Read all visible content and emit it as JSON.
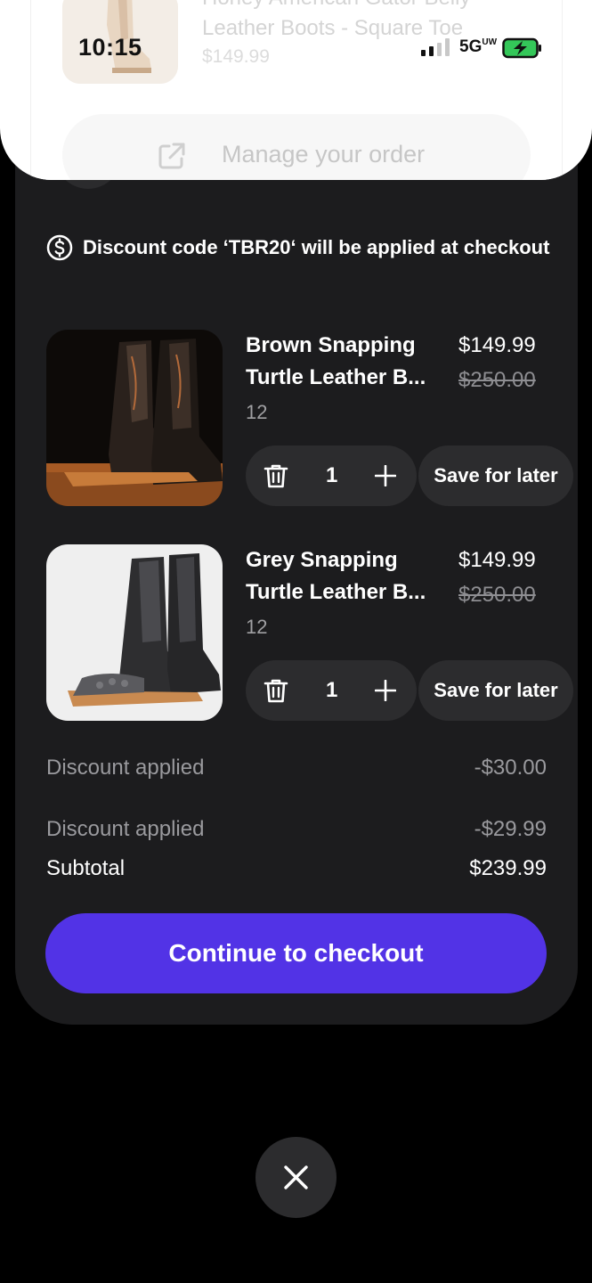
{
  "status_bar": {
    "time": "10:15",
    "network": "5G",
    "signal_bars": 2,
    "battery_state": "charging"
  },
  "order_preview": {
    "title_line1": "Honey American Gator Belly",
    "title_line2": "Leather Boots - Square Toe",
    "price": "$149.99",
    "manage_label": "Manage your order",
    "manage_icon": "external-link-icon"
  },
  "cart": {
    "discount_note": "Discount code ‘TBR20‘ will be applied at checkout",
    "discount_icon": "dollar-circle-icon",
    "items": [
      {
        "name_line1": "Brown Snapping",
        "name_line2": "Turtle Leather B...",
        "size": "12",
        "price": "$149.99",
        "original_price": "$250.00",
        "quantity": "1",
        "save_label": "Save for later"
      },
      {
        "name_line1": "Grey Snapping",
        "name_line2": "Turtle Leather B...",
        "size": "12",
        "price": "$149.99",
        "original_price": "$250.00",
        "quantity": "1",
        "save_label": "Save for later"
      }
    ],
    "summary": [
      {
        "label": "Discount applied",
        "value": "-$30.00"
      },
      {
        "label": "Discount applied",
        "value": "-$29.99"
      },
      {
        "label": "Subtotal",
        "value": "$239.99"
      }
    ],
    "checkout_label": "Continue to checkout"
  },
  "colors": {
    "sheet_bg": "#1c1c1e",
    "control_bg": "#2c2c2e",
    "accent": "#5233e6",
    "battery_fill": "#34c759"
  }
}
